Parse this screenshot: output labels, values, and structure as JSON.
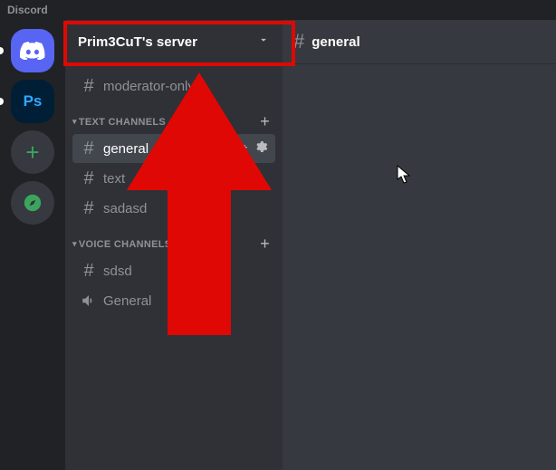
{
  "app": {
    "name": "Discord"
  },
  "rail": {
    "items": [
      {
        "kind": "home"
      },
      {
        "kind": "server",
        "label": "Ps"
      },
      {
        "kind": "add"
      },
      {
        "kind": "explore"
      }
    ]
  },
  "server": {
    "name": "Prim3CuT's server",
    "orphan_channels": [
      {
        "type": "text",
        "name": "moderator-only"
      }
    ],
    "categories": [
      {
        "label": "TEXT CHANNELS",
        "channels": [
          {
            "type": "text",
            "name": "general",
            "selected": true
          },
          {
            "type": "text",
            "name": "text"
          },
          {
            "type": "text",
            "name": "sadasd"
          }
        ]
      },
      {
        "label": "VOICE CHANNELS",
        "channels": [
          {
            "type": "voice",
            "name": "sdsd"
          },
          {
            "type": "voice",
            "name": "General"
          }
        ]
      }
    ]
  },
  "chat": {
    "current_channel": "general"
  },
  "annotation": {
    "highlight_target": "server-header",
    "arrow_color": "#e00804"
  }
}
